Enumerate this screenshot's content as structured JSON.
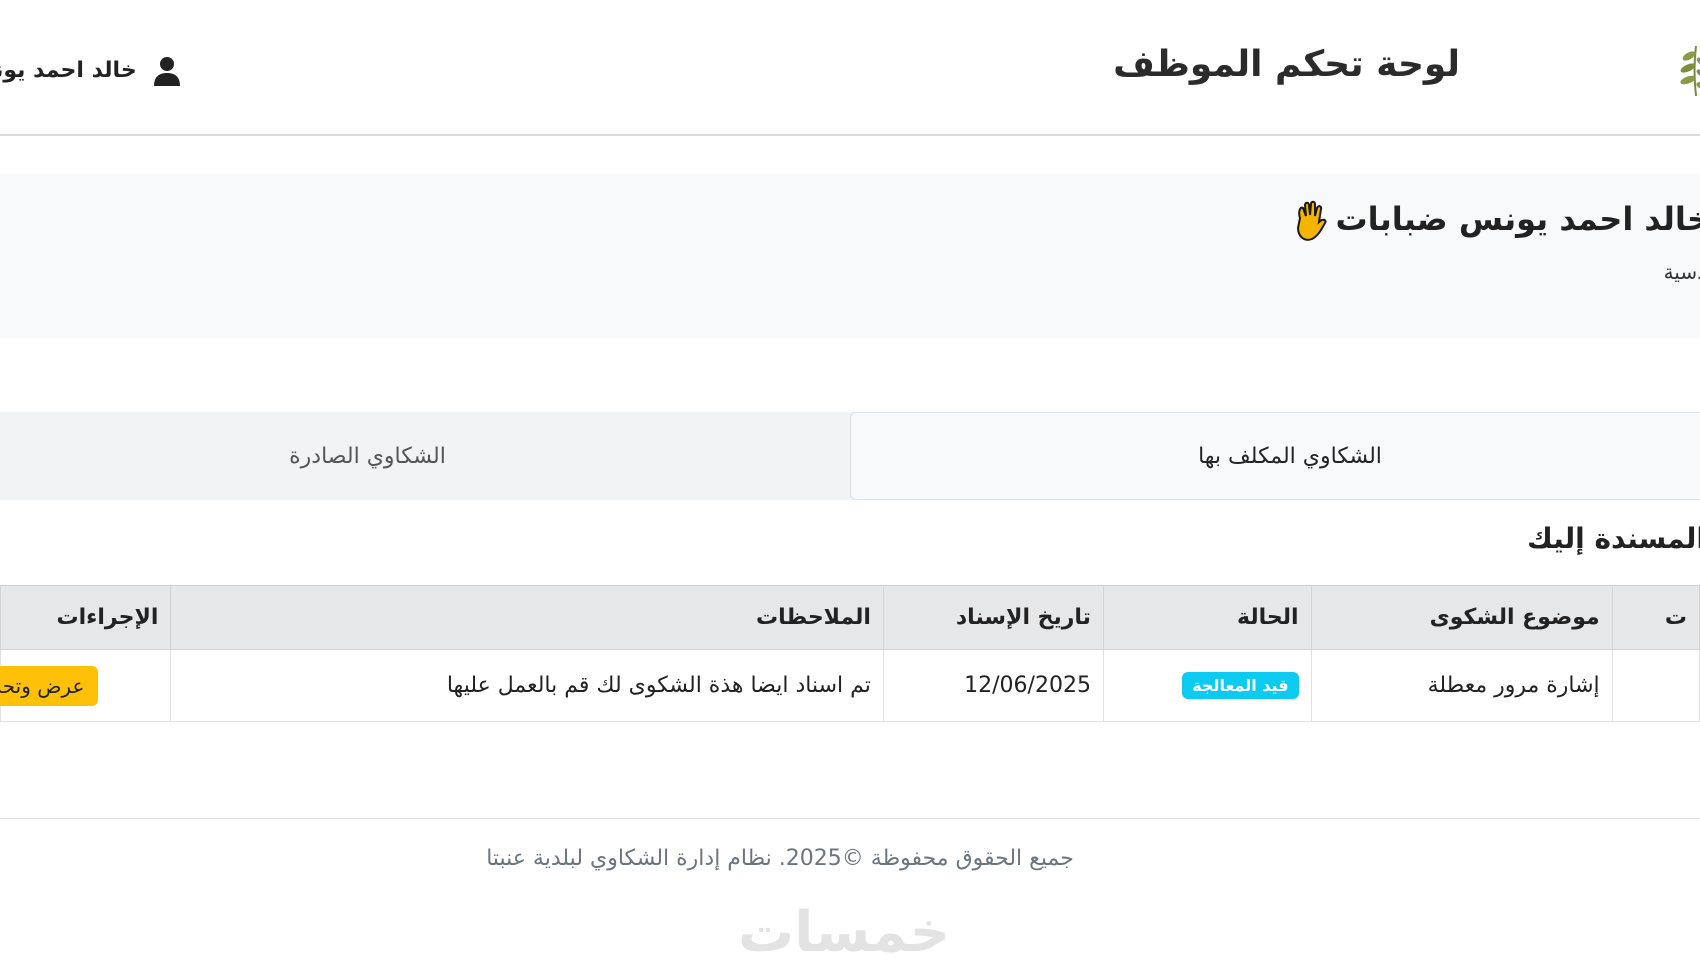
{
  "header": {
    "title": "لوحة تحكم الموظف",
    "user_name": "خالد احمد يونس",
    "logo_icon": "olive-branch-icon",
    "user_icon": "user-icon"
  },
  "welcome": {
    "title": "خالد احمد يونس ضبابات",
    "subtitle": "دسية",
    "icon": "waving-hand-icon"
  },
  "tabs": {
    "assigned": "الشكاوي المكلف بها",
    "issued": "الشكاوي الصادرة"
  },
  "section": {
    "title": "المسندة إليك"
  },
  "table": {
    "headers": {
      "num": "ت",
      "subject": "موضوع الشكوى",
      "status": "الحالة",
      "date": "تاريخ الإسناد",
      "notes": "الملاحظات",
      "actions": "الإجراءات"
    },
    "rows": [
      {
        "num": "",
        "subject": "إشارة مرور معطلة",
        "status": "قيد المعالجة",
        "date": "12/06/2025",
        "notes": "تم اسناد ايضا هذة الشكوى لك قم بالعمل عليها",
        "action": "عرض وتحديث"
      }
    ]
  },
  "footer": {
    "text": "جميع الحقوق محفوظة ©2025. نظام إدارة الشكاوي لبلدية عنبتا"
  },
  "watermark": "خمسات",
  "colors": {
    "status_badge": "#0dcaf0",
    "action_button": "#ffc107",
    "header_border": "#d9d9d9",
    "table_header_bg": "#e6e7e9"
  }
}
